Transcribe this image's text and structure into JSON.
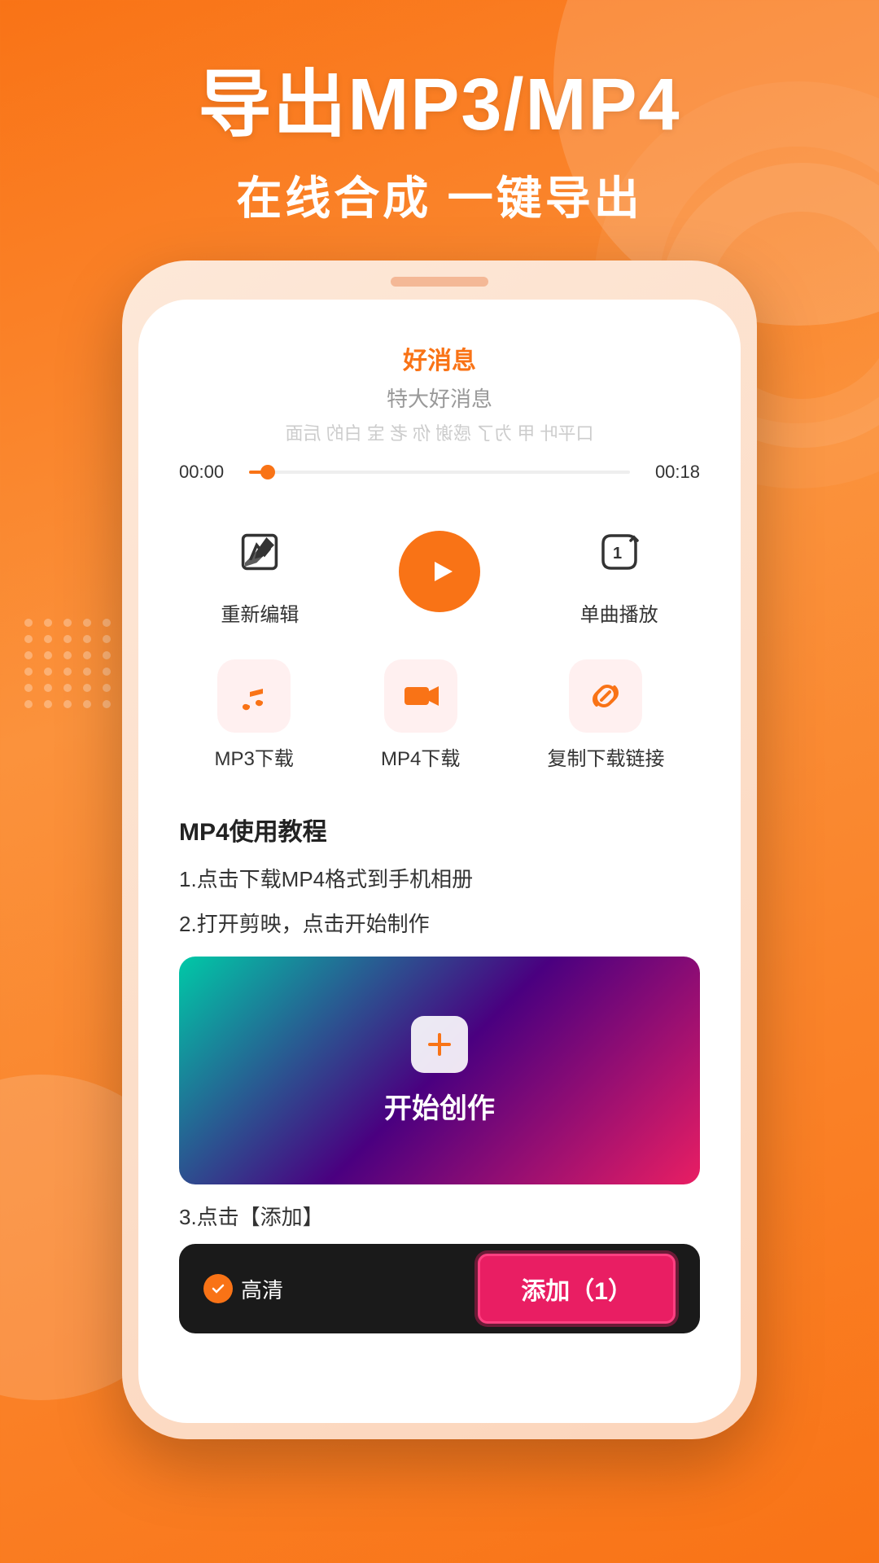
{
  "header": {
    "main_title": "导出MP3/MP4",
    "sub_title": "在线合成  一键导出"
  },
  "player": {
    "news_title": "好消息",
    "news_subtitle": "特大好消息",
    "news_content": "口平叶 甲 为了 感谢 你 老 宝 白的 后面",
    "time_start": "00:00",
    "time_end": "00:18"
  },
  "actions_row1": [
    {
      "label": "重新编辑",
      "icon": "edit-icon"
    },
    {
      "label": "",
      "icon": "play-icon",
      "type": "play"
    },
    {
      "label": "单曲播放",
      "icon": "repeat-one-icon"
    }
  ],
  "actions_row2": [
    {
      "label": "MP3下载",
      "icon": "music-icon"
    },
    {
      "label": "MP4下载",
      "icon": "video-icon"
    },
    {
      "label": "复制下载链接",
      "icon": "link-icon"
    }
  ],
  "tutorial": {
    "title": "MP4使用教程",
    "steps": [
      "1.点击下载MP4格式到手机相册",
      "2.打开剪映，点击开始制作",
      "3.点击【添加】"
    ],
    "video_label": "开始创作"
  },
  "add_bar": {
    "hd_label": "高清",
    "add_button_label": "添加（1）"
  }
}
